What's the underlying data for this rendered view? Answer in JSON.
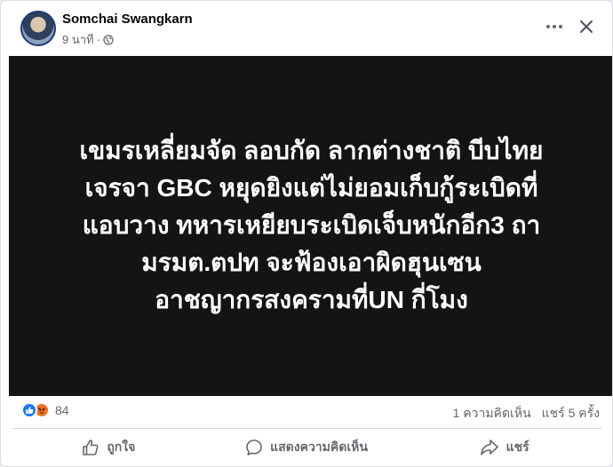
{
  "post": {
    "author": "Somchai Swangkarn",
    "time": "9 นาที",
    "dot": "·",
    "privacy_icon": "globe-icon",
    "text": "เขมรเหลี่ยมจัด ลอบกัด ลากต่างชาติ บีบไทย\nเจรจา GBC หยุดยิงแต่ไม่ยอมเก็บกู้ระเบิดที่\nแอบวาง ทหารเหยียบระเบิดเจ็บหนักอีก3 ถา\nมรมต.ตปท จะฟ้องเอาผิดฮุนเซน\nอาชญากรสงครามที่UN กี่โมง",
    "image_background": "#141414"
  },
  "stats": {
    "reaction_icons": [
      "like-icon",
      "angry-icon"
    ],
    "reaction_count": "84",
    "comments": "1 ความคิดเห็น",
    "shares": "แชร์ 5 ครั้ง"
  },
  "actions": {
    "like": "ถูกใจ",
    "comment": "แสดงความคิดเห็น",
    "share": "แชร์"
  },
  "colors": {
    "accent": "#1877f2",
    "angry": "#f0702a",
    "secondary_text": "#65676b"
  }
}
